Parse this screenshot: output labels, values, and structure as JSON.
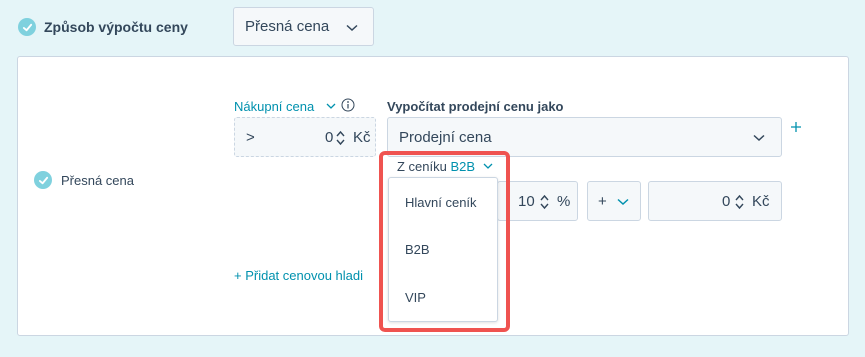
{
  "pricing_method": {
    "label": "Způsob výpočtu ceny",
    "selected": "Přesná cena"
  },
  "exact_price": {
    "label": "Přesná cena",
    "purchase_price_label": "Nákupní cena",
    "operator": ">",
    "purchase_value": "0",
    "currency": "Kč",
    "calc_label": "Vypočítat prodejní cenu jako",
    "calc_selected": "Prodejní cena",
    "source_prefix": "Z ceníku",
    "source_selected": "B2B",
    "percent_value": "10",
    "percent_unit": "%",
    "sign": "+",
    "add_value": "0",
    "add_currency": "Kč",
    "add_level_link": "+ Přidat cenovou hladi"
  },
  "dropdown": {
    "options": [
      "Hlavní ceník",
      "B2B",
      "VIP"
    ]
  },
  "colors": {
    "accent": "#0091ae",
    "check": "#7fd1de",
    "highlight": "#ef5350"
  }
}
